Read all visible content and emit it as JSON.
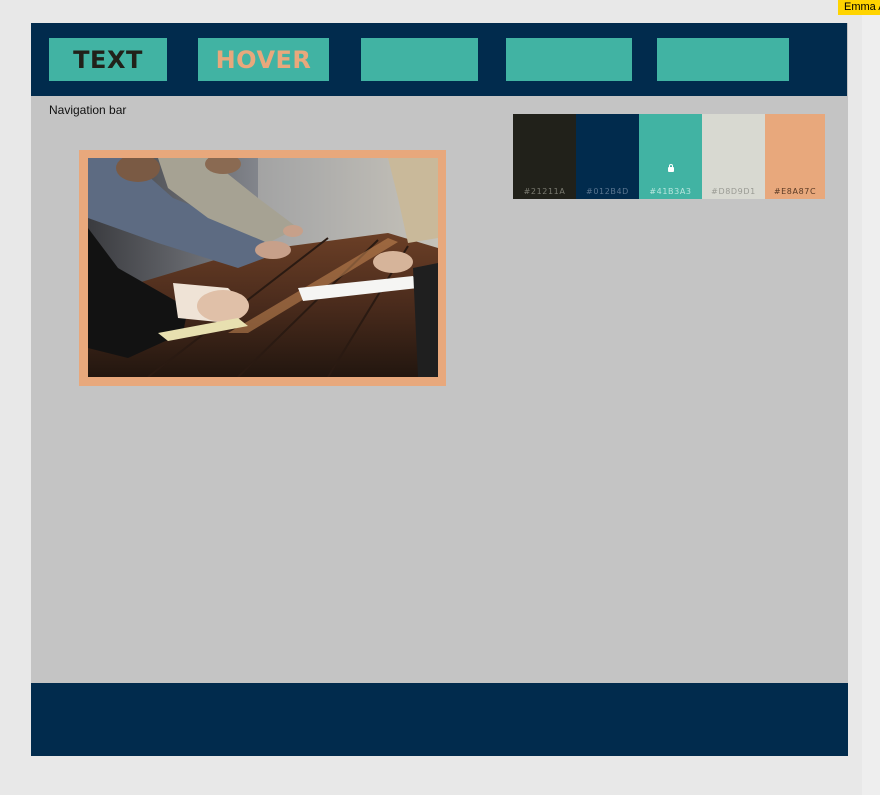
{
  "canvas": {
    "collaborator_tag": "Emma A"
  },
  "navbar": {
    "buttons": [
      {
        "label": "TEXT"
      },
      {
        "label": "HOVER"
      },
      {
        "label": ""
      },
      {
        "label": ""
      },
      {
        "label": ""
      }
    ],
    "caption": "Navigation bar"
  },
  "palette": {
    "swatches": [
      {
        "hex": "#21211A",
        "color": "#21211a",
        "text_color": "#7a7a70"
      },
      {
        "hex": "#012B4D",
        "color": "#012b4d",
        "text_color": "#5a7590"
      },
      {
        "hex": "#41B3A3",
        "color": "#41b3a3",
        "text_color": "#b8e6de",
        "locked": true
      },
      {
        "hex": "#D8D9D1",
        "color": "#d8d9d1",
        "text_color": "#9a9b94"
      },
      {
        "hex": "#E8A87C",
        "color": "#e8a87c",
        "text_color": "#5a3a24"
      }
    ]
  },
  "hero_image": {
    "description_icon": "meeting-photo",
    "border_color": "#e8a87c"
  },
  "colors": {
    "navbar_bg": "#012b4d",
    "button_bg": "#41b3a3",
    "frame_bg": "#c4c4c4",
    "footer_bg": "#012b4d"
  }
}
